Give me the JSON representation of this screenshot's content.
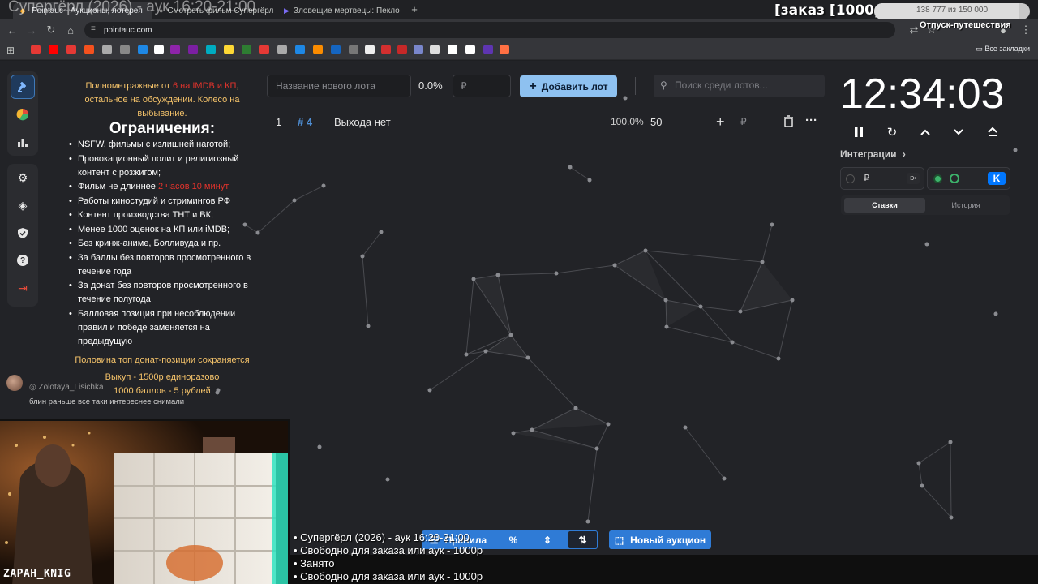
{
  "browser": {
    "tabs": [
      {
        "label": "Pointauc - Аукционы, лотерея"
      },
      {
        "label": "Смотреть фильм Супергёрл"
      },
      {
        "label": "Зловещие мертвецы: Пекло (2"
      }
    ],
    "new_tab_icon": "plus-icon",
    "url": "pointauc.com",
    "all_bookmarks": "Все закладки"
  },
  "sidebar": {
    "items": [
      {
        "icon": "gavel-icon"
      },
      {
        "icon": "pie-chart-icon"
      },
      {
        "icon": "bar-chart-icon"
      },
      {
        "icon": "gear-icon"
      },
      {
        "icon": "layers-icon"
      },
      {
        "icon": "shield-icon"
      },
      {
        "icon": "help-icon"
      },
      {
        "icon": "logout-icon"
      }
    ]
  },
  "rules": {
    "intro_a": "Полнометражные от ",
    "intro_red": "6 на IMDB и КП",
    "intro_b": ", остальное на обсуждении. Колесо на выбывание.",
    "heading": "Ограничения:",
    "items": [
      "NSFW, фильмы с излишней наготой;",
      "Провокационный полит и религиозный контент с розжигом;",
      "Фильм не длиннее ",
      "Работы киностудий и стримингов РФ",
      "Контент производства ТНТ и ВК;",
      "Менее 1000 оценок на КП или iMDB;",
      "Без кринж-аниме, Болливуда и пр.",
      "За баллы без повторов просмотренного в течение года",
      "За донат без повторов просмотренного в течение полугода",
      "Балловая позиция при несоблюдении правил и победе заменяется на предыдущую"
    ],
    "duration_red": "2 часов 10 минут",
    "footer_1": "Половина топ донат-позиции сохраняется",
    "footer_2": "Выкуп - 1500р единоразово",
    "footer_3": "1000 баллов - 5 рублей"
  },
  "chat": {
    "nick": "Zolotaya_Lisichka",
    "message": "блин раньше все таки интереснее снимали"
  },
  "webcam": {
    "label": "ZAPAH_KNIG"
  },
  "lot_form": {
    "name_placeholder": "Название нового лота",
    "percent": "0.0%",
    "amount_placeholder": "₽",
    "add_label": "Добавить лот",
    "search_placeholder": "Поиск среди лотов..."
  },
  "lots": [
    {
      "index": "1",
      "id": "# 4",
      "name": "Выхода нет",
      "percent": "100.0%",
      "amount": "50",
      "currency": "₽"
    }
  ],
  "timer": {
    "time": "12:34:03"
  },
  "integrations": {
    "title": "Интеграции",
    "currency": "₽",
    "tabs": [
      {
        "label": "Ставки"
      },
      {
        "label": "История"
      }
    ]
  },
  "bottom": {
    "rules_label": "Правила",
    "new_auction_label": "Новый аукцион"
  },
  "overlay": {
    "title": "Супергёрл (2026) - аук 16:20-21:00",
    "order": "[заказ [1000р]",
    "progress_text": "138 777 из 150 000",
    "progress_fraction": 0.925,
    "vacation": "Отпуск-путешествия",
    "list": [
      "• Супергёрл (2026) - аук 16:20-21:00",
      "• Свободно для заказа или аук - 1000р",
      "• Занято",
      "• Свободно для заказа или аук - 1000р"
    ]
  },
  "colors": {
    "accent": "#2f7bd6",
    "add_button": "#8ec1f0",
    "rule_red": "#e0332c",
    "rule_yellow": "#f5c36a"
  }
}
